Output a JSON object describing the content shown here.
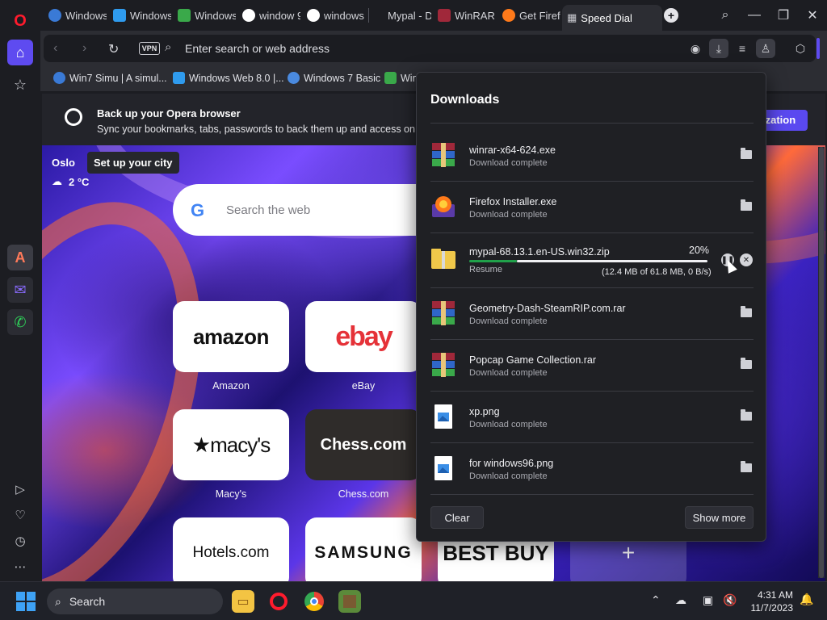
{
  "tabs": [
    {
      "label": "Windows",
      "icon": "earth-globe-icon"
    },
    {
      "label": "Windows",
      "icon": "windows-logo-icon"
    },
    {
      "label": "Windows",
      "icon": "winrar-like-icon"
    },
    {
      "label": "window 9",
      "icon": "google-icon"
    },
    {
      "label": "windows",
      "icon": "google-icon"
    },
    {
      "label": "Mypal - D",
      "icon": "blank-icon"
    },
    {
      "label": "WinRAR",
      "icon": "winrar-icon"
    },
    {
      "label": "Get Firefo",
      "icon": "firefox-icon"
    },
    {
      "label": "Speed Dial",
      "icon": "speed-dial-grid-icon"
    }
  ],
  "address": {
    "vpn_label": "VPN",
    "placeholder": "Enter search or web address"
  },
  "bookmarks": [
    {
      "label": "Win7 Simu | A simul..."
    },
    {
      "label": "Windows Web 8.0 |..."
    },
    {
      "label": "Windows 7 Basic"
    },
    {
      "label": "Win"
    }
  ],
  "banner": {
    "title": "Back up your Opera browser",
    "text": "Sync your bookmarks, tabs, passwords to back them up and access on connected devices",
    "button": "ization"
  },
  "weather": {
    "city": "Oslo",
    "setup": "Set up your city",
    "temp": "2 °C"
  },
  "search": {
    "placeholder": "Search the web"
  },
  "speed_dial": [
    {
      "label": "Amazon",
      "logo": "amazon"
    },
    {
      "label": "eBay",
      "logo": "ebay"
    },
    {
      "label": "Macy's",
      "logo": "★macy's"
    },
    {
      "label": "Chess.com",
      "logo": "Chess.com"
    },
    {
      "label": "",
      "logo": "Hotels.com"
    },
    {
      "label": "",
      "logo": "SAMSUNG"
    },
    {
      "label": "",
      "logo": "BEST BUY"
    }
  ],
  "downloads": {
    "title": "Downloads",
    "items": [
      {
        "name": "winrar-x64-624.exe",
        "status": "Download complete",
        "type": "winrar"
      },
      {
        "name": "Firefox Installer.exe",
        "status": "Download complete",
        "type": "firefox"
      },
      {
        "name": "mypal-68.13.1.en-US.win32.zip",
        "status": "Resume",
        "type": "zip",
        "percent": "20%",
        "progress": 0.2,
        "size": "(12.4 MB of 61.8 MB, 0 B/s)"
      },
      {
        "name": "Geometry-Dash-SteamRIP.com.rar",
        "status": "Download complete",
        "type": "winrar"
      },
      {
        "name": "Popcap Game Collection.rar",
        "status": "Download complete",
        "type": "winrar"
      },
      {
        "name": "xp.png",
        "status": "Download complete",
        "type": "image"
      },
      {
        "name": "for windows96.png",
        "status": "Download complete",
        "type": "image"
      }
    ],
    "clear": "Clear",
    "show_more": "Show more"
  },
  "taskbar": {
    "search": "Search",
    "time": "4:31 AM",
    "date": "11/7/2023"
  },
  "colors": {
    "accent": "#5e4bf0",
    "opera_red": "#ff1b2d",
    "progress": "#20a14a"
  }
}
